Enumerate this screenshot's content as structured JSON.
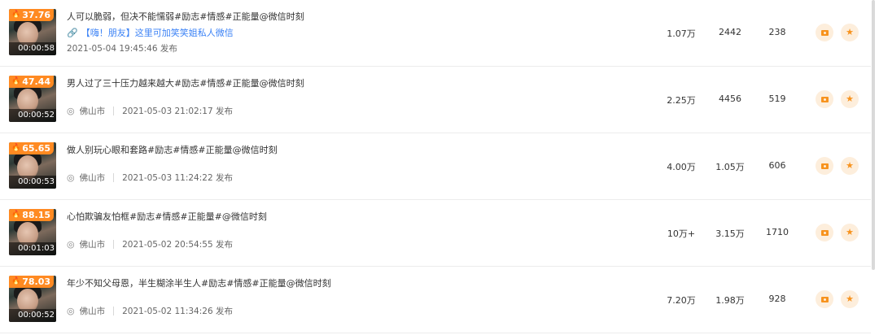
{
  "rows": [
    {
      "heat": "37.76",
      "duration": "00:00:58",
      "title": "人可以脆弱，但决不能懦弱#励志#情感#正能量@微信时刻",
      "link": "【嗨！朋友】这里可加笑笑姐私人微信",
      "location": "",
      "date": "2021-05-04 19:45:46 发布",
      "plays": "1.07万",
      "likes": "2442",
      "comments": "238"
    },
    {
      "heat": "47.44",
      "duration": "00:00:52",
      "title": "男人过了三十压力越来越大#励志#情感#正能量@微信时刻",
      "link": "",
      "location": "佛山市",
      "date": "2021-05-03 21:02:17 发布",
      "plays": "2.25万",
      "likes": "4456",
      "comments": "519"
    },
    {
      "heat": "65.65",
      "duration": "00:00:53",
      "title": "做人别玩心眼和套路#励志#情感#正能量@微信时刻",
      "link": "",
      "location": "佛山市",
      "date": "2021-05-03 11:24:22 发布",
      "plays": "4.00万",
      "likes": "1.05万",
      "comments": "606"
    },
    {
      "heat": "88.15",
      "duration": "00:01:03",
      "title": "心怕欺骗友怕框#励志#情感#正能量#@微信时刻",
      "link": "",
      "location": "佛山市",
      "date": "2021-05-02 20:54:55 发布",
      "plays": "10万+",
      "likes": "3.15万",
      "comments": "1710"
    },
    {
      "heat": "78.03",
      "duration": "00:00:52",
      "title": "年少不知父母恩，半生糊涂半生人#励志#情感#正能量@微信时刻",
      "link": "",
      "location": "佛山市",
      "date": "2021-05-02 11:34:26 发布",
      "plays": "7.20万",
      "likes": "1.98万",
      "comments": "928"
    }
  ],
  "icons": {
    "heat": "flame-icon",
    "link": "link-icon",
    "location": "location-pin-icon",
    "action1": "video-camera-icon",
    "action2": "star-icon"
  },
  "colors": {
    "heat_badge": "#ff8a22",
    "link": "#3b82f6",
    "action_bg": "#fdeedc",
    "action_fg": "#f7931e"
  }
}
